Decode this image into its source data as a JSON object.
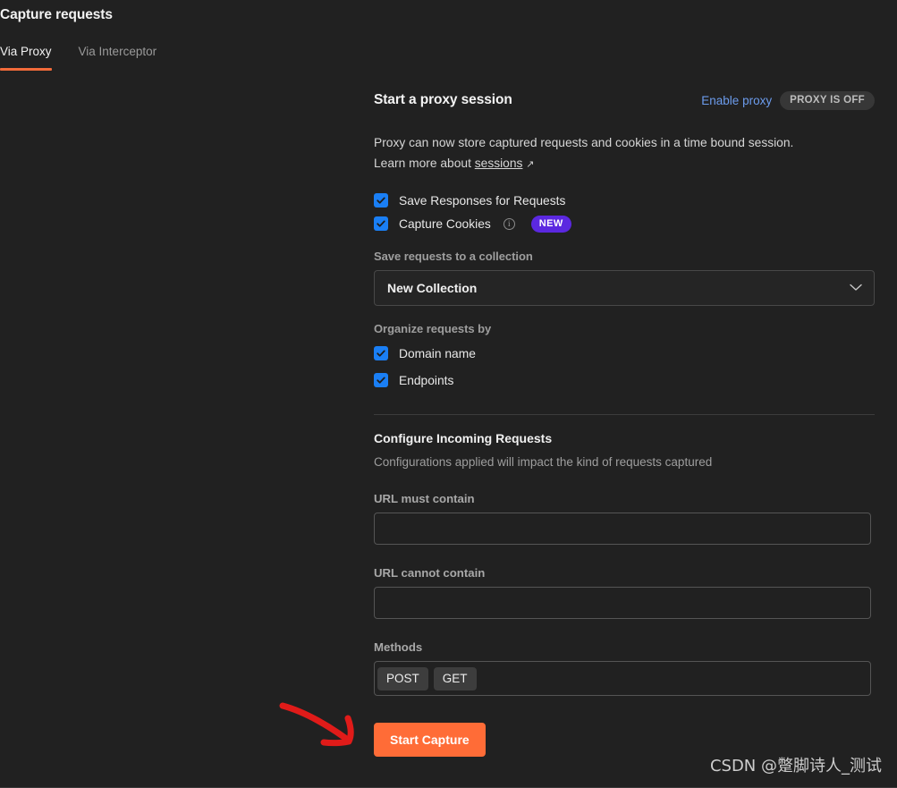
{
  "header": {
    "title": "Capture requests",
    "tabs": [
      {
        "label": "Via Proxy",
        "active": true
      },
      {
        "label": "Via Interceptor",
        "active": false
      }
    ]
  },
  "panel": {
    "title": "Start a proxy session",
    "enable_proxy_link": "Enable proxy",
    "proxy_status": "PROXY IS OFF",
    "description_line1": "Proxy can now store captured requests and cookies in a time bound session.",
    "description_line2_prefix": "Learn more about ",
    "description_link": "sessions",
    "external_link_glyph": "↗",
    "options": [
      {
        "label": "Save Responses for Requests",
        "checked": true,
        "has_info": false,
        "badge": null
      },
      {
        "label": "Capture Cookies",
        "checked": true,
        "has_info": true,
        "badge": "NEW"
      }
    ],
    "collection": {
      "label": "Save requests to a collection",
      "selected": "New Collection"
    },
    "organize": {
      "label": "Organize requests by",
      "options": [
        {
          "label": "Domain name",
          "checked": true
        },
        {
          "label": "Endpoints",
          "checked": true
        }
      ]
    },
    "configure": {
      "title": "Configure Incoming Requests",
      "subtitle": "Configurations applied will impact the kind of requests captured",
      "url_must_contain": {
        "label": "URL must contain",
        "value": "",
        "placeholder": ""
      },
      "url_cannot_contain": {
        "label": "URL cannot contain",
        "value": "",
        "placeholder": ""
      },
      "methods": {
        "label": "Methods",
        "chips": [
          "POST",
          "GET"
        ]
      }
    },
    "start_button": "Start Capture"
  },
  "annotation": {
    "arrow_color": "#e01b19"
  },
  "watermark": "CSDN @蹩脚诗人_测试",
  "colors": {
    "background": "#212121",
    "accent_orange": "#ff6c37",
    "tab_underline": "#f26b3a",
    "checkbox_blue": "#1a7ff5",
    "link_blue": "#6c9ced",
    "badge_purple": "#5b28e0",
    "status_pill_bg": "#373737"
  }
}
